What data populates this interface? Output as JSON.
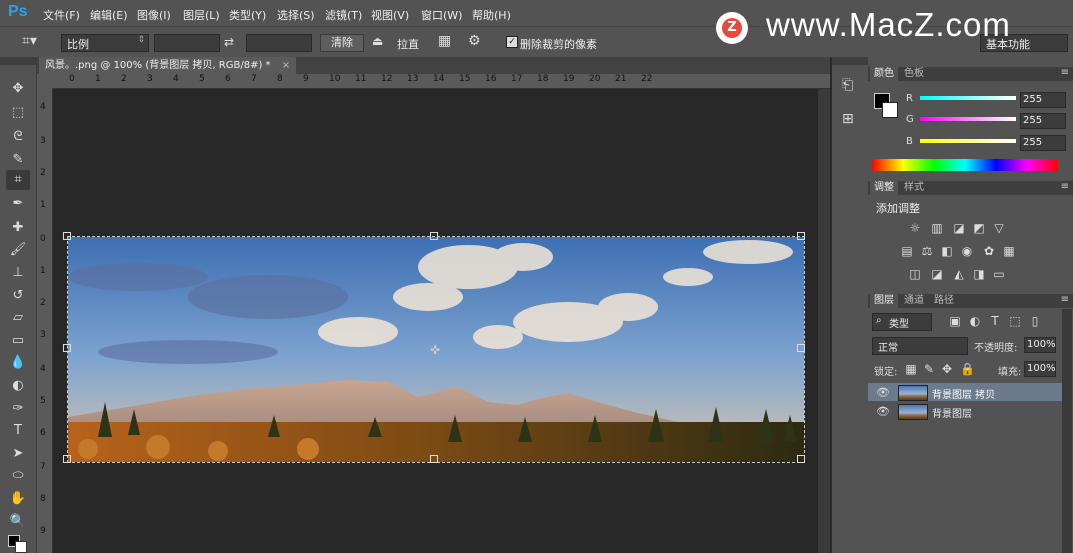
{
  "app": {
    "logo": "Ps"
  },
  "menu": [
    "文件(F)",
    "编辑(E)",
    "图像(I)",
    "图层(L)",
    "类型(Y)",
    "选择(S)",
    "滤镜(T)",
    "视图(V)",
    "窗口(W)",
    "帮助(H)"
  ],
  "options": {
    "ratio": "比例",
    "clear_label": "清除",
    "straighten_label": "拉直",
    "delete_cropped_label": "删除裁剪的像素",
    "delete_cropped_checked": true,
    "workspace": "基本功能"
  },
  "document": {
    "tab_title": "风景。.png @ 100% (背景图层 拷贝, RGB/8#) *",
    "ruler_h": [
      "0",
      "1",
      "2",
      "3",
      "4",
      "5",
      "6",
      "7",
      "8",
      "9",
      "10",
      "11",
      "12",
      "13",
      "14",
      "15",
      "16",
      "17",
      "18",
      "19",
      "20",
      "21",
      "22"
    ],
    "ruler_v": [
      "4",
      "3",
      "2",
      "1",
      "0",
      "1",
      "2",
      "3",
      "4",
      "5",
      "6",
      "7",
      "8",
      "9"
    ]
  },
  "color_panel": {
    "tabs": [
      "颜色",
      "色板"
    ],
    "r_label": "R",
    "r": "255",
    "g_label": "G",
    "g": "255",
    "b_label": "B",
    "b": "255"
  },
  "adjust_panel": {
    "tabs": [
      "调整",
      "样式"
    ],
    "title": "添加调整"
  },
  "layers_panel": {
    "tabs": [
      "图层",
      "通道",
      "路径"
    ],
    "filter": "类型",
    "blend_mode": "正常",
    "opacity_label": "不透明度:",
    "opacity": "100%",
    "lock_label": "锁定:",
    "fill_label": "填充:",
    "fill": "100%",
    "layers": [
      {
        "name": "背景图层 拷贝",
        "selected": true
      },
      {
        "name": "背景图层",
        "selected": false
      }
    ]
  },
  "watermark": {
    "text": "www.MacZ.com",
    "logo_letter": "Z"
  },
  "colors": {
    "accent": "#2aa0f0",
    "panel": "#535353",
    "canvas": "#282828",
    "watermark_logo": "#e64a3b"
  }
}
